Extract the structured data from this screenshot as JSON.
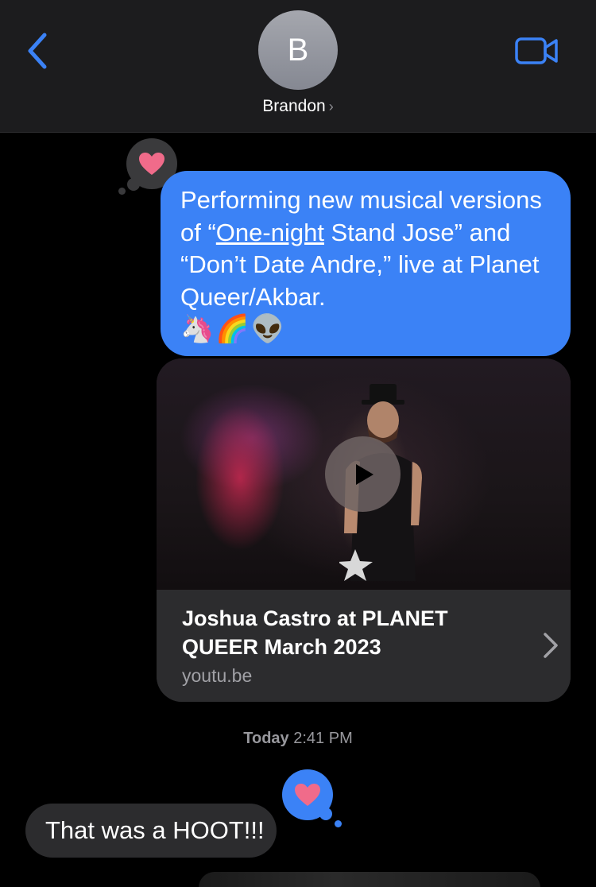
{
  "header": {
    "avatar_initial": "B",
    "contact_name": "Brandon",
    "contact_chevron": "›",
    "back_icon": "chevron-left-icon",
    "video_icon": "video-camera-icon"
  },
  "messages": {
    "outgoing": {
      "text_before_link": "Performing new musical versions of “",
      "link_text": "One-night",
      "text_after_link": " Stand Jose” and “Don’t Date Andre,” live at Planet Queer/Akbar.",
      "emojis": "🦄🌈👽",
      "reaction": "heart"
    },
    "link_preview": {
      "title": "Joshua Castro at PLANET QUEER March 2023",
      "domain": "youtu.be"
    },
    "timestamp_day": "Today",
    "timestamp_time": "2:41 PM",
    "incoming": {
      "text": "That was a HOOT!!!",
      "reaction": "heart"
    }
  },
  "colors": {
    "accent": "#3b82f6",
    "heart": "#f06b8a",
    "bubble_gray": "#2c2c2e",
    "header_bg": "#1c1c1e"
  }
}
